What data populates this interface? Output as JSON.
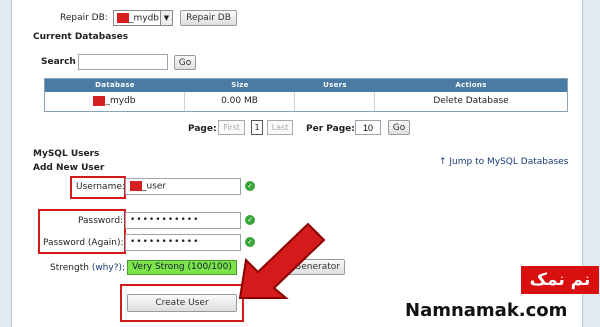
{
  "repair": {
    "label": "Repair DB:",
    "selected_db_suffix": "_mydb",
    "button": "Repair DB"
  },
  "current_databases": {
    "heading": "Current Databases",
    "search_label": "Search",
    "search_value": "",
    "go": "Go",
    "columns": [
      "Database",
      "Size",
      "Users",
      "Actions"
    ],
    "rows": [
      {
        "name_suffix": "_mydb",
        "size": "0.00 MB",
        "users": "",
        "action": "Delete Database"
      }
    ],
    "pager": {
      "page_label": "Page:",
      "first": "First",
      "current": "1",
      "last": "Last",
      "per_page_label": "Per Page:",
      "per_page_value": "10",
      "go": "Go"
    }
  },
  "mysql_users": {
    "heading": "MySQL Users",
    "subheading": "Add New User",
    "jump_link": "↑ Jump to MySQL Databases",
    "username_label": "Username:",
    "username_suffix": "_user",
    "password_label": "Password:",
    "password_value": "•••••••••••",
    "password_again_label": "Password (Again):",
    "password_again_value": "•••••••••••",
    "strength_label": "Strength",
    "strength_why": "(why?)",
    "strength_colon": ":",
    "strength_value": "Very Strong (100/100)",
    "generator_button": "Generator",
    "create_button": "Create User"
  },
  "watermark": {
    "persian": "نم نمک",
    "english": "Namnamak.com"
  },
  "colors": {
    "accent_blue": "#4a7ba3",
    "highlight_red": "#d41a1a",
    "strength_green": "#7de34a",
    "check_green": "#3aa53a"
  },
  "icons": {
    "validation": "check-circle-icon",
    "select": "chevron-down-icon",
    "arrow": "red-pointer-arrow-icon"
  }
}
